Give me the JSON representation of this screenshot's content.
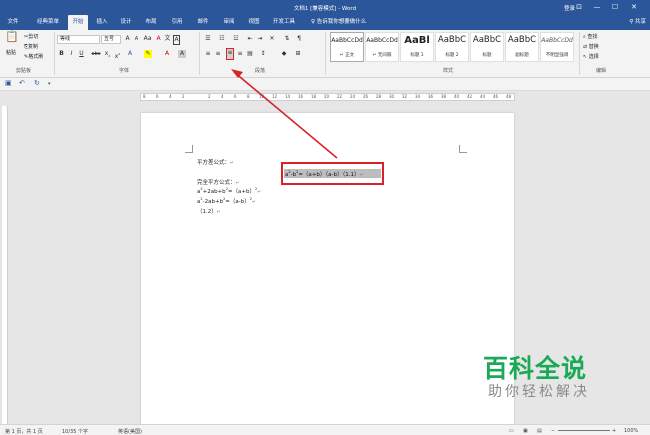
{
  "window": {
    "title": "文档1 [兼容模式] - Word",
    "login": "登录",
    "controls": [
      "⊡",
      "—",
      "☐",
      "✕"
    ]
  },
  "tabs": [
    "文件",
    "经典菜单",
    "开始",
    "插入",
    "设计",
    "布局",
    "引用",
    "邮件",
    "审阅",
    "视图",
    "开发工具"
  ],
  "active_tab": "开始",
  "tell_me": "告诉我你想要做什么",
  "share": "共享",
  "clipboard": {
    "paste": "粘贴",
    "cut": "剪切",
    "copy": "复制",
    "format_painter": "格式刷",
    "label": "剪贴板"
  },
  "font": {
    "name": "等线",
    "size": "五号",
    "grow": "A",
    "shrink": "A",
    "case": "Aa",
    "clear": "A",
    "phonetic": "文",
    "border_char": "A",
    "bold": "B",
    "italic": "I",
    "underline": "U",
    "strike": "abc",
    "sub": "x",
    "sup": "x",
    "label": "字体"
  },
  "paragraph": {
    "label": "段落"
  },
  "styles": {
    "items": [
      {
        "sample": "AaBbCcDd",
        "name": "↵ 正文"
      },
      {
        "sample": "AaBbCcDd",
        "name": "↵ 无间隔"
      },
      {
        "sample": "AaBl",
        "name": "标题 1"
      },
      {
        "sample": "AaBbC",
        "name": "标题 2"
      },
      {
        "sample": "AaBbC",
        "name": "标题"
      },
      {
        "sample": "AaBbC",
        "name": "副标题"
      },
      {
        "sample": "AaBbCcDd",
        "name": "不明显强调"
      }
    ],
    "label": "样式"
  },
  "editing": {
    "find": "查找",
    "replace": "替换",
    "select": "选择",
    "label": "编辑"
  },
  "ruler_numbers": [
    "8",
    "6",
    "4",
    "2",
    "2",
    "4",
    "6",
    "8",
    "10",
    "12",
    "14",
    "16",
    "18",
    "20",
    "22",
    "24",
    "26",
    "28",
    "30",
    "32",
    "34",
    "36",
    "38",
    "40",
    "42",
    "44",
    "46",
    "48"
  ],
  "document": {
    "line1": "平方差公式：",
    "line2": "完全平方公式：",
    "line3_pre": "a",
    "line3_sup1": "2",
    "line3_mid": "+2ab+b",
    "line3_sup2": "2",
    "line3_post": "=（a+b）",
    "line3_sup3": "2",
    "line4_pre": "a",
    "line4_sup1": "2",
    "line4_mid": "-2ab+b",
    "line4_sup2": "2",
    "line4_post": "=（a-b）",
    "line4_sup3": "2",
    "line5": "（1.2）",
    "pm": "↵"
  },
  "formula": {
    "pre": "a",
    "sup1": "2",
    "mid": "-b",
    "sup2": "2",
    "post": "=（a+b）（a-b）（1.1）"
  },
  "status": {
    "page": "第 1 页，共 1 页",
    "words": "10/35 个字",
    "lang": "英语(美国)",
    "zoom": "100%"
  },
  "watermark": {
    "title": "百科全说",
    "subtitle": "助你轻松解决"
  },
  "colors": {
    "accent": "#2b579a",
    "highlight_border": "#d9232a",
    "watermark": "#1aaa55"
  }
}
